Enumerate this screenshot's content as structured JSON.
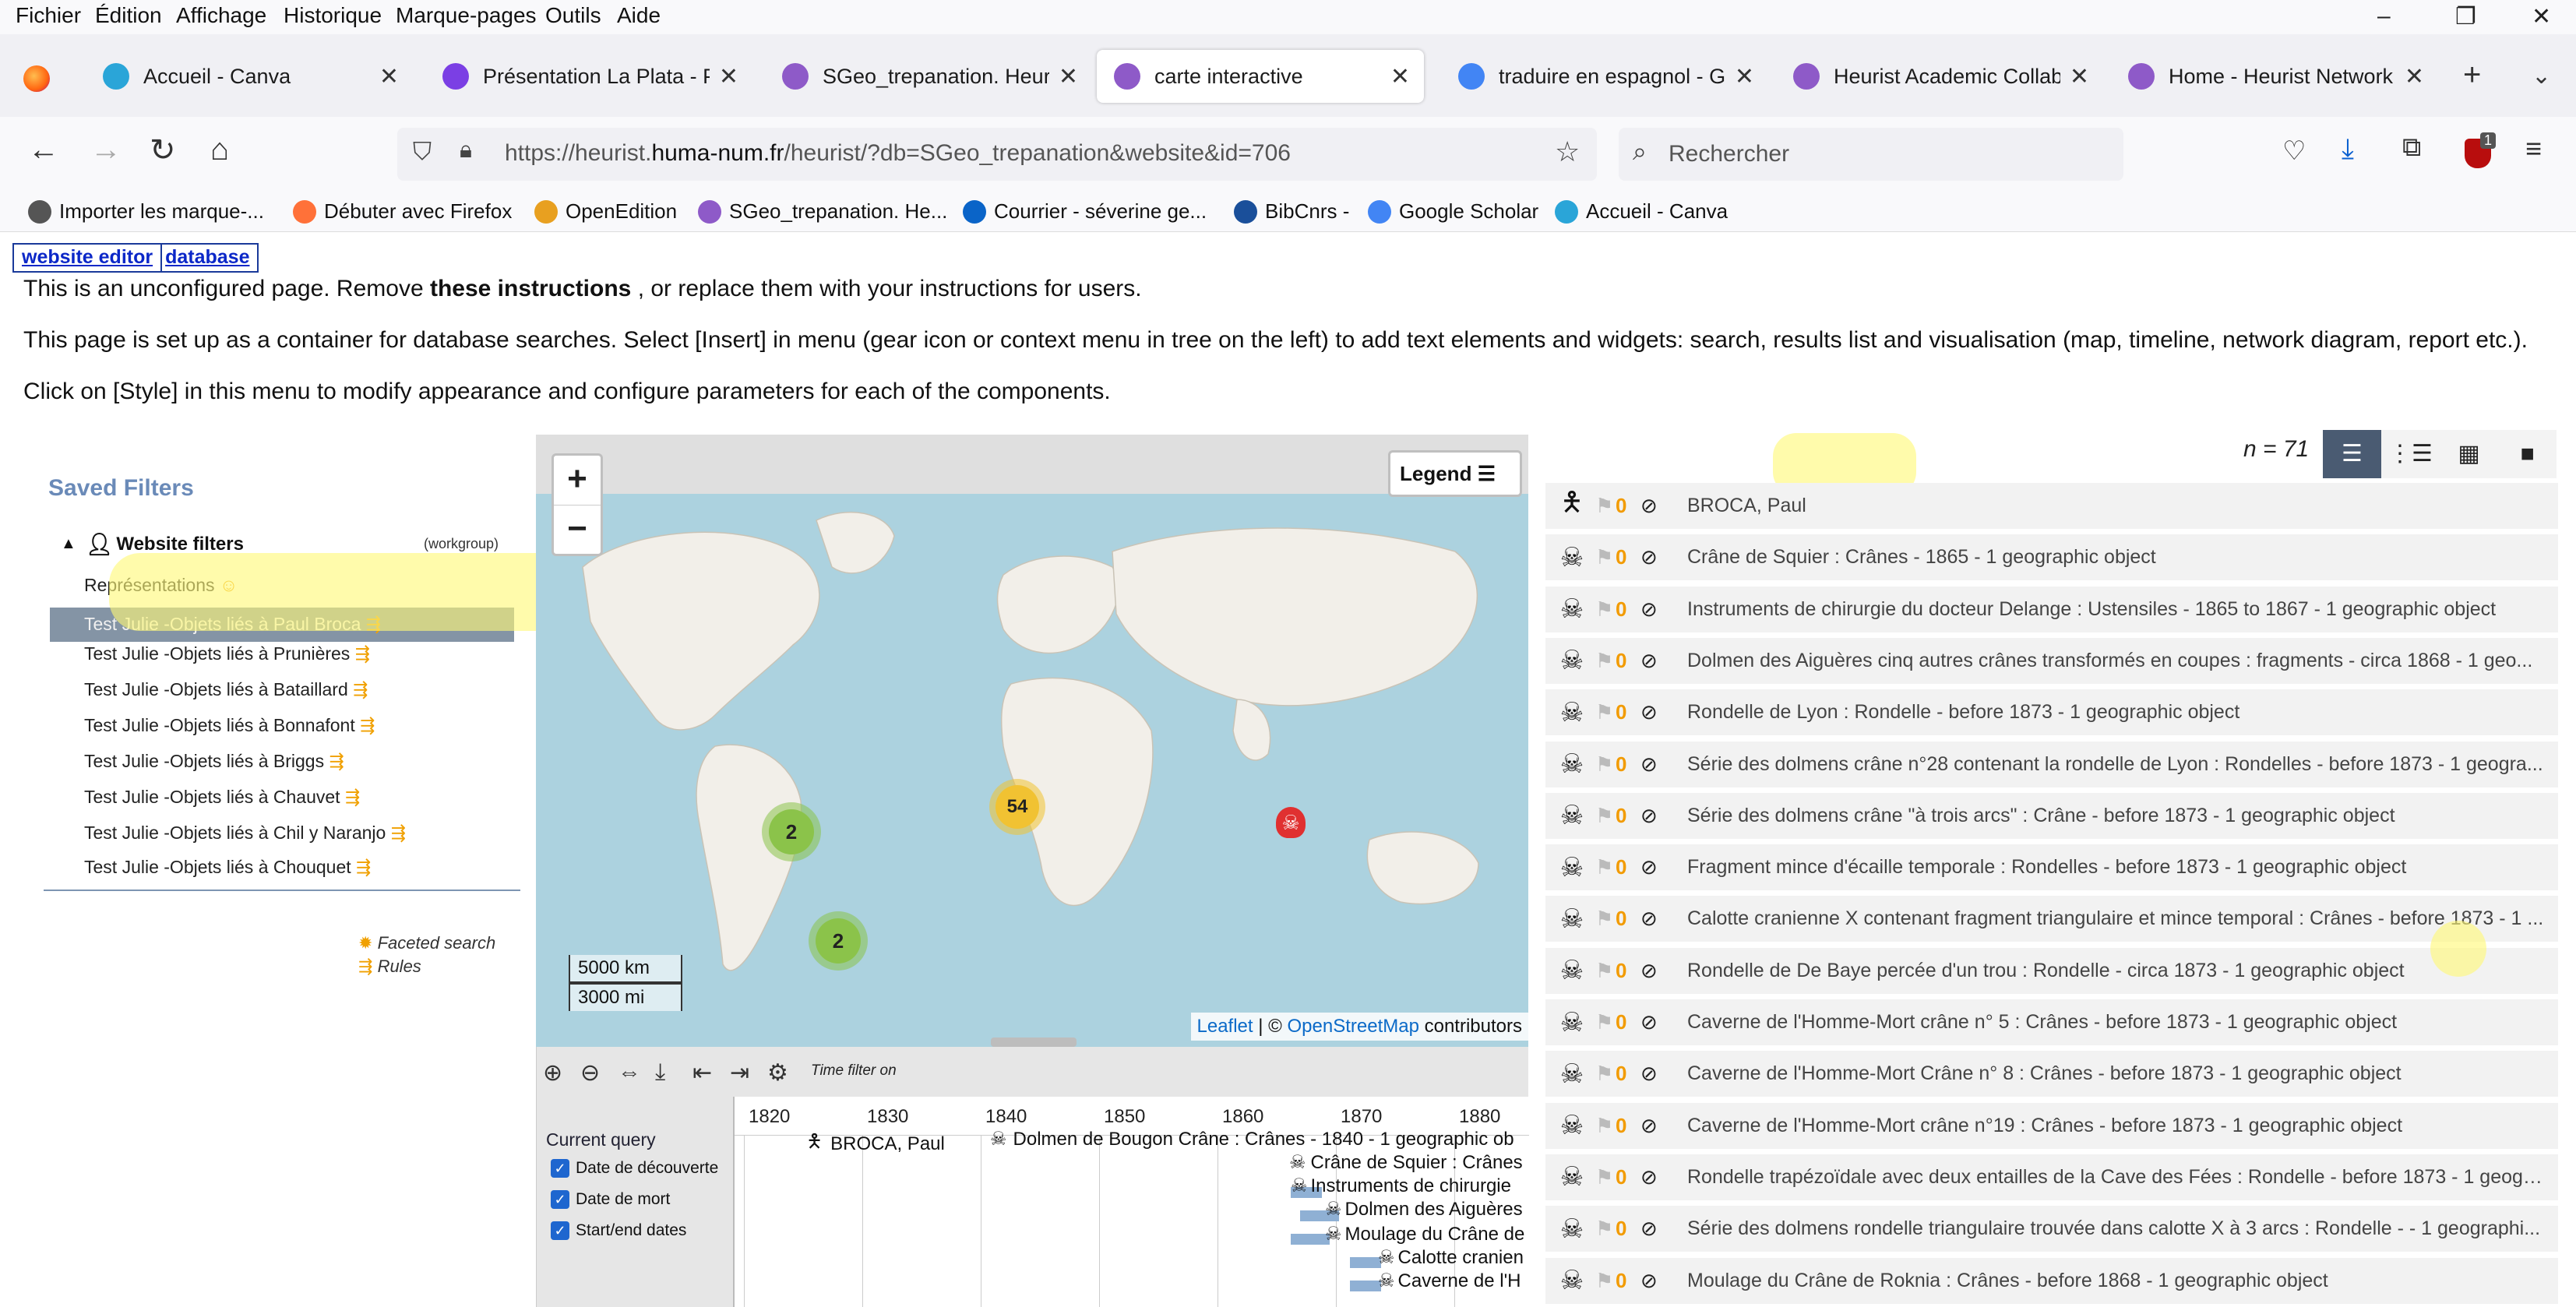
{
  "menubar": {
    "items": [
      "Fichier",
      "Édition",
      "Affichage",
      "Historique",
      "Marque-pages",
      "Outils",
      "Aide"
    ]
  },
  "window_controls": {
    "minimize": "–",
    "maximize": "❐",
    "close": "✕"
  },
  "tabs": [
    {
      "title": "Accueil - Canva",
      "color": "#2aa5d8"
    },
    {
      "title": "Présentation La Plata - Prés",
      "color": "#7b3fe4"
    },
    {
      "title": "SGeo_trepanation. Heurist V",
      "color": "#8e5ac8"
    },
    {
      "title": "carte interactive",
      "color": "#8e5ac8"
    },
    {
      "title": "traduire en espagnol - Goo",
      "color": "#4285f4"
    },
    {
      "title": "Heurist Academic Collabor",
      "color": "#8e5ac8"
    },
    {
      "title": "Home - Heurist Network",
      "color": "#8e5ac8"
    }
  ],
  "active_tab_index": 3,
  "url": {
    "prefix": "https://heurist.",
    "domain": "huma-num.fr",
    "suffix": "/heurist/?db=SGeo_trepanation&website&id=706"
  },
  "search_placeholder": "Rechercher",
  "extensions_badge": "1",
  "bookmarks": [
    {
      "label": "Importer les marque-...",
      "color": "#555555"
    },
    {
      "label": "Débuter avec Firefox",
      "color": "#ff7139"
    },
    {
      "label": "OpenEdition",
      "color": "#e8a020"
    },
    {
      "label": "SGeo_trepanation. He...",
      "color": "#8e5ac8"
    },
    {
      "label": "Courrier - séverine ge...",
      "color": "#0a64c8"
    },
    {
      "label": "BibCnrs -",
      "color": "#1a4f9a"
    },
    {
      "label": "Google Scholar",
      "color": "#4285f4"
    },
    {
      "label": "Accueil - Canva",
      "color": "#2aa5d8"
    }
  ],
  "editor_links": {
    "website_editor": "website editor",
    "database": "database"
  },
  "instructions": {
    "line1_a": "This is an unconfigured page. Remove ",
    "line1_b": "these instructions",
    "line1_c": " , or replace them with your instructions for users.",
    "line2": "This page is set up as a container for database searches. Select [Insert] in menu (gear icon or context menu in tree on the left) to add text elements and widgets: search, results list and visualisation (map, timeline, network diagram, report etc.).",
    "line3": "Click on [Style] in this menu to modify appearance and configure parameters for each of the components."
  },
  "saved_filters": {
    "title": "Saved Filters",
    "group_label": "Website filters",
    "group_scope": "(workgroup)",
    "items": [
      "Représentations",
      "Test Julie -Objets liés à Paul Broca",
      "Test Julie -Objets liés à Prunières",
      "Test Julie -Objets liés à Bataillard",
      "Test Julie -Objets liés à Bonnafont",
      "Test Julie -Objets liés à Briggs",
      "Test Julie -Objets liés à Chauvet",
      "Test Julie -Objets liés à Chil y Naranjo",
      "Test Julie -Objets liés à Chouquet"
    ],
    "selected_index": 1,
    "faceted_search": "Faceted search",
    "rules": "Rules"
  },
  "map": {
    "zoom_in": "+",
    "zoom_out": "−",
    "legend": "Legend",
    "clusters": [
      {
        "label": "54",
        "color": "#f1c232"
      },
      {
        "label": "2",
        "color": "#8bc34a"
      },
      {
        "label": "2",
        "color": "#8bc34a"
      }
    ],
    "scale_km": "5000 km",
    "scale_mi": "3000 mi",
    "attribution_leaflet": "Leaflet",
    "attribution_sep": " | © ",
    "attribution_osm": "OpenStreetMap",
    "attribution_tail": " contributors"
  },
  "timeline": {
    "filter_label": "Time filter on",
    "current_query": "Current query",
    "checkboxes": [
      "Date de découverte",
      "Date de mort",
      "Start/end dates"
    ],
    "years": [
      "1820",
      "1830",
      "1840",
      "1850",
      "1860",
      "1870",
      "1880"
    ],
    "events": [
      "BROCA, Paul",
      "Dolmen de Bougon Crâne : Crânes - 1840 - 1 geographic ob",
      "Crâne de Squier : Crânes",
      "Instruments de chirurgie",
      "Dolmen des Aiguères",
      "Moulage du Crâne de",
      "Calotte cranien",
      "Caverne de l'H"
    ]
  },
  "results": {
    "count": "n = 71",
    "view_modes": [
      "list",
      "list-detail",
      "thumbnails",
      "single"
    ],
    "active_view": 0,
    "flag_count": "0",
    "rows": [
      {
        "icon": "person",
        "text": "BROCA, Paul"
      },
      {
        "icon": "skull",
        "text": "Crâne de Squier : Crânes - 1865 - 1 geographic object"
      },
      {
        "icon": "skull",
        "text": "Instruments de chirurgie du docteur Delange : Ustensiles - 1865 to 1867 - 1 geographic object"
      },
      {
        "icon": "skull",
        "text": "Dolmen des Aiguères cinq autres crânes transformés en coupes : fragments - circa 1868 - 1 geo..."
      },
      {
        "icon": "skull",
        "text": "Rondelle de Lyon : Rondelle - before 1873 - 1 geographic object"
      },
      {
        "icon": "skull",
        "text": "Série des dolmens crâne n°28 contenant la rondelle de Lyon : Rondelles - before 1873 - 1 geogra..."
      },
      {
        "icon": "skull",
        "text": "Série des dolmens crâne \"à trois arcs\" : Crâne - before 1873 - 1 geographic object"
      },
      {
        "icon": "skull",
        "text": "Fragment mince d'écaille temporale : Rondelles - before 1873 - 1 geographic object"
      },
      {
        "icon": "skull",
        "text": "Calotte cranienne X contenant fragment triangulaire et mince temporal : Crânes - before 1873 - 1 ..."
      },
      {
        "icon": "skull",
        "text": "Rondelle de De Baye percée d'un trou : Rondelle - circa 1873 - 1 geographic object"
      },
      {
        "icon": "skull",
        "text": "Caverne de l'Homme-Mort crâne n° 5 : Crânes - before 1873 - 1 geographic object"
      },
      {
        "icon": "skull",
        "text": "Caverne de l'Homme-Mort Crâne n° 8 : Crânes - before 1873 - 1 geographic object"
      },
      {
        "icon": "skull",
        "text": "Caverne de l'Homme-Mort crâne n°19 : Crânes - before 1873 - 1 geographic object"
      },
      {
        "icon": "skull",
        "text": "Rondelle trapézoïdale avec deux entailles de la Cave des Fées : Rondelle - before 1873 - 1 geogr..."
      },
      {
        "icon": "skull",
        "text": "Série des dolmens rondelle triangulaire trouvée dans calotte X à 3 arcs : Rondelle - - 1 geographi..."
      },
      {
        "icon": "skull",
        "text": "Moulage du Crâne de Roknia : Crânes - before 1868 - 1 geographic object"
      }
    ]
  }
}
